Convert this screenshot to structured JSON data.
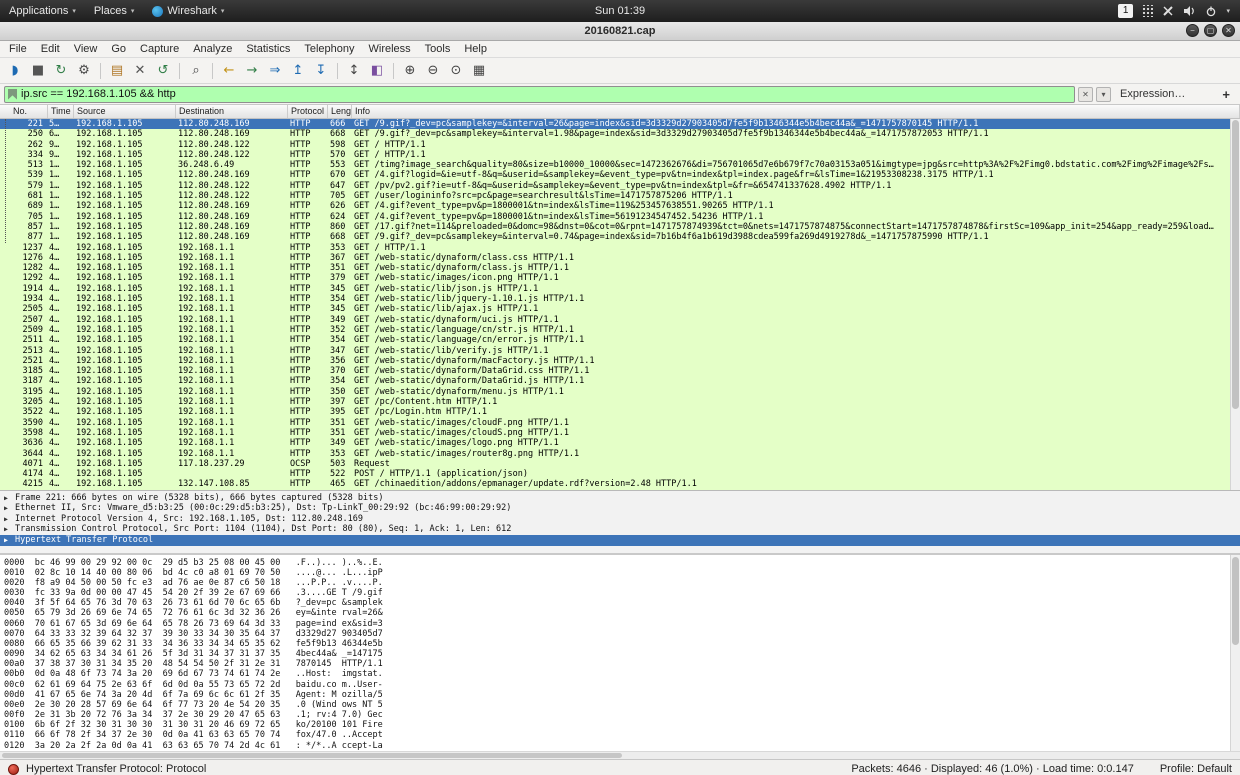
{
  "desktop": {
    "menus": [
      "Applications",
      "Places",
      "Wireshark"
    ],
    "clock": "Sun 01:39",
    "workspace_indicator": "1"
  },
  "window": {
    "title": "20160821.cap"
  },
  "menubar": [
    "File",
    "Edit",
    "View",
    "Go",
    "Capture",
    "Analyze",
    "Statistics",
    "Telephony",
    "Wireless",
    "Tools",
    "Help"
  ],
  "toolbar": {
    "items": [
      {
        "name": "start-capture-icon",
        "glyph": "◗",
        "color": "#1d6ab2"
      },
      {
        "name": "stop-capture-icon",
        "glyph": "■",
        "color": "#555555"
      },
      {
        "name": "restart-capture-icon",
        "glyph": "↻",
        "color": "#2f7d46"
      },
      {
        "name": "capture-options-icon",
        "glyph": "⚙",
        "color": "#4a4a4a"
      },
      {
        "sep": true
      },
      {
        "name": "open-file-icon",
        "glyph": "▤",
        "color": "#b07828"
      },
      {
        "name": "close-file-icon",
        "glyph": "✕",
        "color": "#555555"
      },
      {
        "name": "reload-file-icon",
        "glyph": "↺",
        "color": "#2f7d46"
      },
      {
        "sep": true
      },
      {
        "name": "find-packet-icon",
        "glyph": "⌕",
        "color": "#444444"
      },
      {
        "sep": true
      },
      {
        "name": "go-back-icon",
        "glyph": "←",
        "color": "#c29218"
      },
      {
        "name": "go-forward-icon",
        "glyph": "→",
        "color": "#2f7d46"
      },
      {
        "name": "go-to-packet-icon",
        "glyph": "⇒",
        "color": "#1d6ab2"
      },
      {
        "name": "go-first-icon",
        "glyph": "↥",
        "color": "#1d6ab2"
      },
      {
        "name": "go-last-icon",
        "glyph": "↧",
        "color": "#1d6ab2"
      },
      {
        "sep": true
      },
      {
        "name": "autoscroll-icon",
        "glyph": "↕",
        "color": "#444444"
      },
      {
        "name": "colorize-icon",
        "glyph": "◧",
        "color": "#7a4fa0"
      },
      {
        "sep": true
      },
      {
        "name": "zoom-in-icon",
        "glyph": "⊕",
        "color": "#444444"
      },
      {
        "name": "zoom-out-icon",
        "glyph": "⊖",
        "color": "#444444"
      },
      {
        "name": "zoom-normal-icon",
        "glyph": "⊙",
        "color": "#444444"
      },
      {
        "name": "resize-columns-icon",
        "glyph": "▦",
        "color": "#444444"
      }
    ]
  },
  "filter": {
    "value": "ip.src == 192.168.1.105 && http",
    "expression_label": "Expression…",
    "add_label": "+"
  },
  "packet_list": {
    "columns": [
      "No.",
      "Time",
      "Source",
      "Destination",
      "Protocol",
      "Length",
      "Info"
    ],
    "rows": [
      {
        "no": "221",
        "time": "5…",
        "src": "192.168.1.105",
        "dst": "112.80.248.169",
        "proto": "HTTP",
        "len": "666",
        "info": "GET /9.gif?_dev=pc&samplekey=&interval=26&page=index&sid=3d3329d27903405d7fe5f9b1346344e5b4bec44a&_=1471757870145 HTTP/1.1",
        "selected": true
      },
      {
        "no": "250",
        "time": "6…",
        "src": "192.168.1.105",
        "dst": "112.80.248.169",
        "proto": "HTTP",
        "len": "668",
        "info": "GET /9.gif?_dev=pc&samplekey=&interval=1.98&page=index&sid=3d3329d27903405d7fe5f9b1346344e5b4bec44a&_=1471757872053 HTTP/1.1"
      },
      {
        "no": "262",
        "time": "9…",
        "src": "192.168.1.105",
        "dst": "112.80.248.122",
        "proto": "HTTP",
        "len": "598",
        "info": "GET / HTTP/1.1"
      },
      {
        "no": "334",
        "time": "9…",
        "src": "192.168.1.105",
        "dst": "112.80.248.122",
        "proto": "HTTP",
        "len": "570",
        "info": "GET / HTTP/1.1"
      },
      {
        "no": "513",
        "time": "1…",
        "src": "192.168.1.105",
        "dst": "36.248.6.49",
        "proto": "HTTP",
        "len": "553",
        "info": "GET /timg?image_search&quality=80&size=b10000_10000&sec=1472362676&di=756701065d7e6b679f7c70a03153a051&imgtype=jpg&src=http%3A%2F%2Fimg0.bdstatic.com%2Fimg%2Fimage%2Fs…"
      },
      {
        "no": "539",
        "time": "1…",
        "src": "192.168.1.105",
        "dst": "112.80.248.169",
        "proto": "HTTP",
        "len": "670",
        "info": "GET /4.gif?logid=&ie=utf-8&q=&userid=&samplekey=&event_type=pv&tn=index&tpl=index.page&fr=&lsTime=1&21953308238.3175 HTTP/1.1"
      },
      {
        "no": "579",
        "time": "1…",
        "src": "192.168.1.105",
        "dst": "112.80.248.122",
        "proto": "HTTP",
        "len": "647",
        "info": "GET /pv/pv2.gif?ie=utf-8&q=&userid=&samplekey=&event_type=pv&tn=index&tpl=&fr=&654741337628.4902 HTTP/1.1"
      },
      {
        "no": "681",
        "time": "1…",
        "src": "192.168.1.105",
        "dst": "112.80.248.122",
        "proto": "HTTP",
        "len": "705",
        "info": "GET /user/logininfo?src=pc&page=searchresult&lsTime=1471757875206 HTTP/1.1"
      },
      {
        "no": "689",
        "time": "1…",
        "src": "192.168.1.105",
        "dst": "112.80.248.169",
        "proto": "HTTP",
        "len": "626",
        "info": "GET /4.gif?event_type=pv&p=1800001&tn=index&lsTime=119&253457638551.90265 HTTP/1.1"
      },
      {
        "no": "705",
        "time": "1…",
        "src": "192.168.1.105",
        "dst": "112.80.248.169",
        "proto": "HTTP",
        "len": "624",
        "info": "GET /4.gif?event_type=pv&p=1800001&tn=index&lsTime=56191234547452.54236 HTTP/1.1"
      },
      {
        "no": "857",
        "time": "1…",
        "src": "192.168.1.105",
        "dst": "112.80.248.169",
        "proto": "HTTP",
        "len": "860",
        "info": "GET /17.gif?net=114&preloaded=0&domc=98&dnst=0&cot=0&rpnt=1471757874939&tct=0&nets=1471757874875&connectStart=1471757874878&firstSc=109&app_init=254&app_ready=259&load…"
      },
      {
        "no": "877",
        "time": "1…",
        "src": "192.168.1.105",
        "dst": "112.80.248.169",
        "proto": "HTTP",
        "len": "668",
        "info": "GET /9.gif?_dev=pc&samplekey=&interval=0.74&page=index&sid=7b16b4f6a1b619d3988cdea599fa269d4919278d&_=1471757875990 HTTP/1.1"
      },
      {
        "no": "1237",
        "time": "4…",
        "src": "192.168.1.105",
        "dst": "192.168.1.1",
        "proto": "HTTP",
        "len": "353",
        "info": "GET / HTTP/1.1"
      },
      {
        "no": "1276",
        "time": "4…",
        "src": "192.168.1.105",
        "dst": "192.168.1.1",
        "proto": "HTTP",
        "len": "367",
        "info": "GET /web-static/dynaform/class.css HTTP/1.1"
      },
      {
        "no": "1282",
        "time": "4…",
        "src": "192.168.1.105",
        "dst": "192.168.1.1",
        "proto": "HTTP",
        "len": "351",
        "info": "GET /web-static/dynaform/class.js HTTP/1.1"
      },
      {
        "no": "1292",
        "time": "4…",
        "src": "192.168.1.105",
        "dst": "192.168.1.1",
        "proto": "HTTP",
        "len": "379",
        "info": "GET /web-static/images/icon.png HTTP/1.1"
      },
      {
        "no": "1914",
        "time": "4…",
        "src": "192.168.1.105",
        "dst": "192.168.1.1",
        "proto": "HTTP",
        "len": "345",
        "info": "GET /web-static/lib/json.js HTTP/1.1"
      },
      {
        "no": "1934",
        "time": "4…",
        "src": "192.168.1.105",
        "dst": "192.168.1.1",
        "proto": "HTTP",
        "len": "354",
        "info": "GET /web-static/lib/jquery-1.10.1.js HTTP/1.1"
      },
      {
        "no": "2505",
        "time": "4…",
        "src": "192.168.1.105",
        "dst": "192.168.1.1",
        "proto": "HTTP",
        "len": "345",
        "info": "GET /web-static/lib/ajax.js HTTP/1.1"
      },
      {
        "no": "2507",
        "time": "4…",
        "src": "192.168.1.105",
        "dst": "192.168.1.1",
        "proto": "HTTP",
        "len": "349",
        "info": "GET /web-static/dynaform/uci.js HTTP/1.1"
      },
      {
        "no": "2509",
        "time": "4…",
        "src": "192.168.1.105",
        "dst": "192.168.1.1",
        "proto": "HTTP",
        "len": "352",
        "info": "GET /web-static/language/cn/str.js HTTP/1.1"
      },
      {
        "no": "2511",
        "time": "4…",
        "src": "192.168.1.105",
        "dst": "192.168.1.1",
        "proto": "HTTP",
        "len": "354",
        "info": "GET /web-static/language/cn/error.js HTTP/1.1"
      },
      {
        "no": "2513",
        "time": "4…",
        "src": "192.168.1.105",
        "dst": "192.168.1.1",
        "proto": "HTTP",
        "len": "347",
        "info": "GET /web-static/lib/verify.js HTTP/1.1"
      },
      {
        "no": "2521",
        "time": "4…",
        "src": "192.168.1.105",
        "dst": "192.168.1.1",
        "proto": "HTTP",
        "len": "356",
        "info": "GET /web-static/dynaform/macFactory.js HTTP/1.1"
      },
      {
        "no": "3185",
        "time": "4…",
        "src": "192.168.1.105",
        "dst": "192.168.1.1",
        "proto": "HTTP",
        "len": "370",
        "info": "GET /web-static/dynaform/DataGrid.css HTTP/1.1"
      },
      {
        "no": "3187",
        "time": "4…",
        "src": "192.168.1.105",
        "dst": "192.168.1.1",
        "proto": "HTTP",
        "len": "354",
        "info": "GET /web-static/dynaform/DataGrid.js HTTP/1.1"
      },
      {
        "no": "3195",
        "time": "4…",
        "src": "192.168.1.105",
        "dst": "192.168.1.1",
        "proto": "HTTP",
        "len": "350",
        "info": "GET /web-static/dynaform/menu.js HTTP/1.1"
      },
      {
        "no": "3205",
        "time": "4…",
        "src": "192.168.1.105",
        "dst": "192.168.1.1",
        "proto": "HTTP",
        "len": "397",
        "info": "GET /pc/Content.htm HTTP/1.1"
      },
      {
        "no": "3522",
        "time": "4…",
        "src": "192.168.1.105",
        "dst": "192.168.1.1",
        "proto": "HTTP",
        "len": "395",
        "info": "GET /pc/Login.htm HTTP/1.1"
      },
      {
        "no": "3590",
        "time": "4…",
        "src": "192.168.1.105",
        "dst": "192.168.1.1",
        "proto": "HTTP",
        "len": "351",
        "info": "GET /web-static/images/cloudF.png HTTP/1.1"
      },
      {
        "no": "3598",
        "time": "4…",
        "src": "192.168.1.105",
        "dst": "192.168.1.1",
        "proto": "HTTP",
        "len": "351",
        "info": "GET /web-static/images/cloudS.png HTTP/1.1"
      },
      {
        "no": "3636",
        "time": "4…",
        "src": "192.168.1.105",
        "dst": "192.168.1.1",
        "proto": "HTTP",
        "len": "349",
        "info": "GET /web-static/images/logo.png HTTP/1.1"
      },
      {
        "no": "3644",
        "time": "4…",
        "src": "192.168.1.105",
        "dst": "192.168.1.1",
        "proto": "HTTP",
        "len": "353",
        "info": "GET /web-static/images/router8g.png HTTP/1.1"
      },
      {
        "no": "4071",
        "time": "4…",
        "src": "192.168.1.105",
        "dst": "117.18.237.29",
        "proto": "OCSP",
        "len": "503",
        "info": "Request"
      },
      {
        "no": "4174",
        "time": "4…",
        "src": "192.168.1.105",
        "dst": "",
        "proto": "HTTP",
        "len": "522",
        "info": "POST / HTTP/1.1  (application/json)"
      },
      {
        "no": "4215",
        "time": "4…",
        "src": "192.168.1.105",
        "dst": "132.147.108.85",
        "proto": "HTTP",
        "len": "465",
        "info": "GET /chinaedition/addons/epmanager/update.rdf?version=2.48 HTTP/1.1"
      }
    ]
  },
  "details": {
    "lines": [
      {
        "text": "Frame 221: 666 bytes on wire (5328 bits), 666 bytes captured (5328 bits)",
        "selected": false
      },
      {
        "text": "Ethernet II, Src: Vmware_d5:b3:25 (00:0c:29:d5:b3:25), Dst: Tp-LinkT_00:29:92 (bc:46:99:00:29:92)",
        "selected": false
      },
      {
        "text": "Internet Protocol Version 4, Src: 192.168.1.105, Dst: 112.80.248.169",
        "selected": false
      },
      {
        "text": "Transmission Control Protocol, Src Port: 1104 (1104), Dst Port: 80 (80), Seq: 1, Ack: 1, Len: 612",
        "selected": false
      },
      {
        "text": "Hypertext Transfer Protocol",
        "selected": true
      }
    ]
  },
  "hexdump": {
    "lines": [
      {
        "offset": "0000",
        "hex": "bc 46 99 00 29 92 00 0c  29 d5 b3 25 08 00 45 00",
        "ascii": ".F..)... )..%..E."
      },
      {
        "offset": "0010",
        "hex": "02 8c 10 14 40 00 80 06  bd 4c c0 a8 01 69 70 50",
        "ascii": "....@... .L...ipP"
      },
      {
        "offset": "0020",
        "hex": "f8 a9 04 50 00 50 fc e3  ad 76 ae 0e 87 c6 50 18",
        "ascii": "...P.P.. .v....P."
      },
      {
        "offset": "0030",
        "hex": "fc 33 9a 0d 00 00 47 45  54 20 2f 39 2e 67 69 66",
        "ascii": ".3....GE T /9.gif"
      },
      {
        "offset": "0040",
        "hex": "3f 5f 64 65 76 3d 70 63  26 73 61 6d 70 6c 65 6b",
        "ascii": "?_dev=pc &samplek"
      },
      {
        "offset": "0050",
        "hex": "65 79 3d 26 69 6e 74 65  72 76 61 6c 3d 32 36 26",
        "ascii": "ey=&inte rval=26&"
      },
      {
        "offset": "0060",
        "hex": "70 61 67 65 3d 69 6e 64  65 78 26 73 69 64 3d 33",
        "ascii": "page=ind ex&sid=3"
      },
      {
        "offset": "0070",
        "hex": "64 33 33 32 39 64 32 37  39 30 33 34 30 35 64 37",
        "ascii": "d3329d27 903405d7"
      },
      {
        "offset": "0080",
        "hex": "66 65 35 66 39 62 31 33  34 36 33 34 34 65 35 62",
        "ascii": "fe5f9b13 46344e5b"
      },
      {
        "offset": "0090",
        "hex": "34 62 65 63 34 34 61 26  5f 3d 31 34 37 31 37 35",
        "ascii": "4bec44a& _=147175"
      },
      {
        "offset": "00a0",
        "hex": "37 38 37 30 31 34 35 20  48 54 54 50 2f 31 2e 31",
        "ascii": "7870145  HTTP/1.1"
      },
      {
        "offset": "00b0",
        "hex": "0d 0a 48 6f 73 74 3a 20  69 6d 67 73 74 61 74 2e",
        "ascii": "..Host:  imgstat."
      },
      {
        "offset": "00c0",
        "hex": "62 61 69 64 75 2e 63 6f  6d 0d 0a 55 73 65 72 2d",
        "ascii": "baidu.co m..User-"
      },
      {
        "offset": "00d0",
        "hex": "41 67 65 6e 74 3a 20 4d  6f 7a 69 6c 6c 61 2f 35",
        "ascii": "Agent: M ozilla/5"
      },
      {
        "offset": "00e0",
        "hex": "2e 30 20 28 57 69 6e 64  6f 77 73 20 4e 54 20 35",
        "ascii": ".0 (Wind ows NT 5"
      },
      {
        "offset": "00f0",
        "hex": "2e 31 3b 20 72 76 3a 34  37 2e 30 29 20 47 65 63",
        "ascii": ".1; rv:4 7.0) Gec"
      },
      {
        "offset": "0100",
        "hex": "6b 6f 2f 32 30 31 30 30  31 30 31 20 46 69 72 65",
        "ascii": "ko/20100 101 Fire"
      },
      {
        "offset": "0110",
        "hex": "66 6f 78 2f 34 37 2e 30  0d 0a 41 63 63 65 70 74",
        "ascii": "fox/47.0 ..Accept"
      },
      {
        "offset": "0120",
        "hex": "3a 20 2a 2f 2a 0d 0a 41  63 63 65 70 74 2d 4c 61",
        "ascii": ": */*..A ccept-La"
      }
    ]
  },
  "statusbar": {
    "field_info": "Hypertext Transfer Protocol: Protocol",
    "counts": "Packets: 4646 · Displayed: 46 (1.0%) · Load time: 0:0.147",
    "profile": "Profile: Default"
  }
}
